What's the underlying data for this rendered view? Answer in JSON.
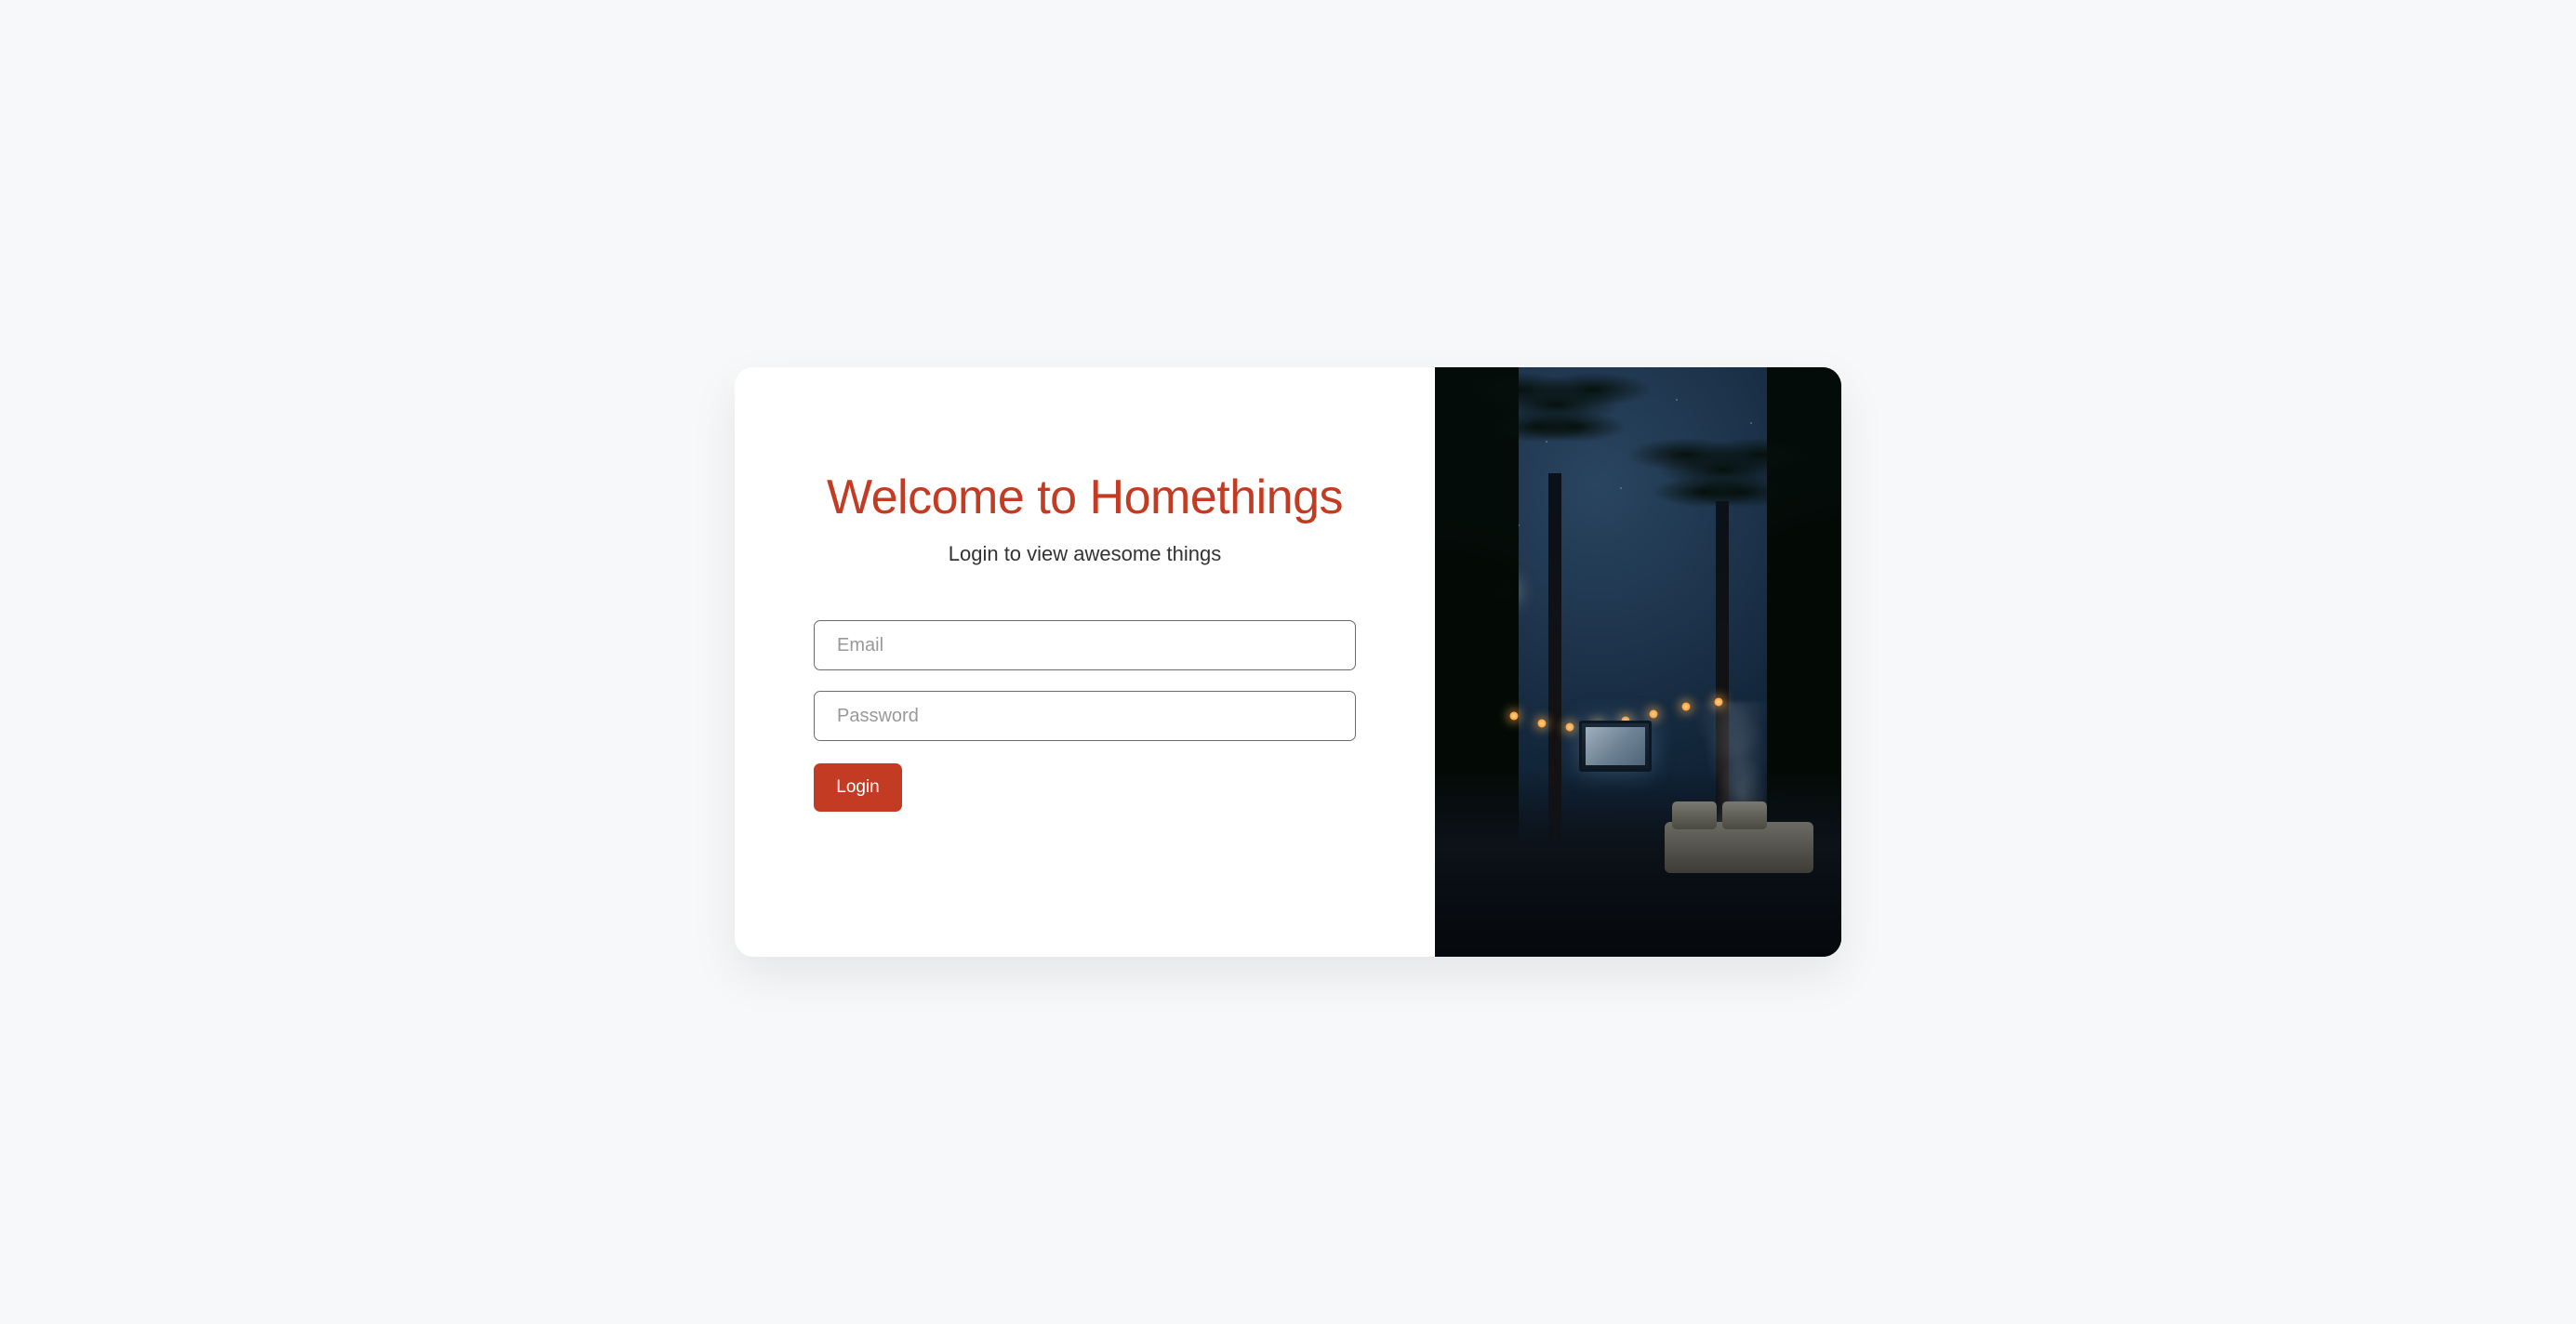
{
  "login": {
    "heading": "Welcome to Homethings",
    "subtitle": "Login to view awesome things",
    "email_placeholder": "Email",
    "password_placeholder": "Password",
    "button_label": "Login"
  },
  "colors": {
    "accent": "#c23b22",
    "background": "#f7f8f9"
  }
}
